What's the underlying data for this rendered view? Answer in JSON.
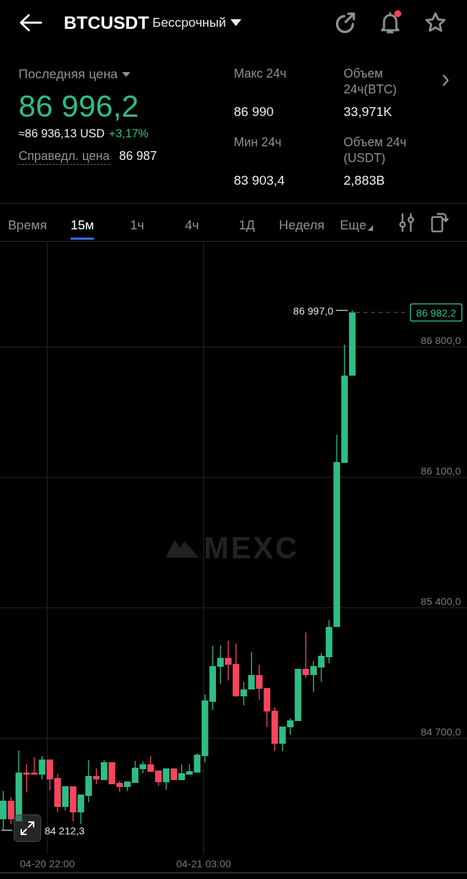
{
  "header": {
    "symbol": "BTCUSDT",
    "contract_type": "Бессрочный",
    "notification_dot": true
  },
  "price_panel": {
    "label": "Последняя цена",
    "last_price": "86 996,2",
    "usd_equivalent": "≈86 936,13 USD",
    "change": "+3,17%",
    "fair_price_label": "Справедл. цена",
    "fair_price": "86 987"
  },
  "stats": [
    {
      "label": "Макс 24ч",
      "value": "86 990"
    },
    {
      "label": "Объем 24ч(BTC)",
      "value": "33,971K"
    },
    {
      "label": "Мин 24ч",
      "value": "83 903,4"
    },
    {
      "label": "Объем 24ч (USDT)",
      "value": "2,883B"
    }
  ],
  "tabs": [
    {
      "label": "Время",
      "kind": "interval",
      "selected": false
    },
    {
      "label": "15м",
      "kind": "interval",
      "selected": true
    },
    {
      "label": "1ч",
      "kind": "interval",
      "selected": false
    },
    {
      "label": "4ч",
      "kind": "interval",
      "selected": false
    },
    {
      "label": "1Д",
      "kind": "interval",
      "selected": false
    },
    {
      "label": "Неделя",
      "kind": "interval",
      "selected": false
    },
    {
      "label": "Еще",
      "kind": "dropdown",
      "selected": false
    }
  ],
  "chart": {
    "watermark": "MEXC",
    "price_axis_labels": [
      "86 800,0",
      "86 100,0",
      "85 400,0",
      "84 700,0"
    ],
    "time_axis_labels": [
      "04-20 22:00",
      "04-21 03:00"
    ],
    "high_marker": "86 997,0",
    "current_price": "86 982,2",
    "low_marker": "84 212,3"
  }
}
